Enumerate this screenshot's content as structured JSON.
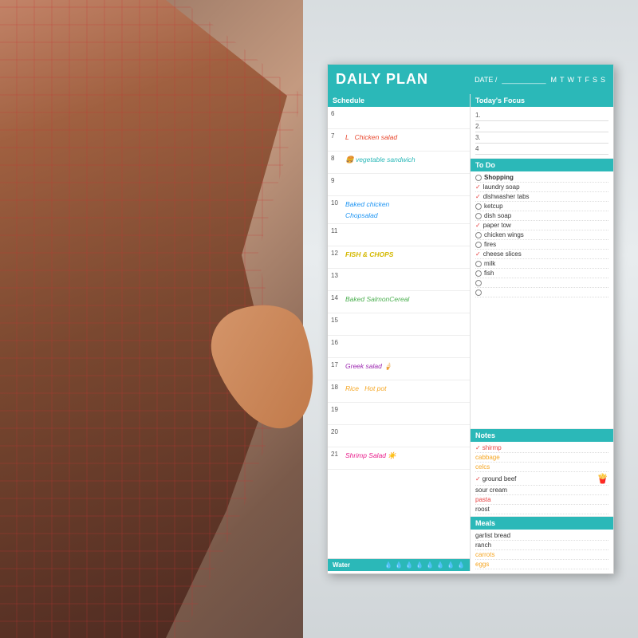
{
  "planner": {
    "title": "DAILY PLAN",
    "date_label": "DATE /",
    "days": [
      "M",
      "T",
      "W",
      "T",
      "F",
      "S",
      "S"
    ],
    "sections": {
      "schedule": "Schedule",
      "todays_focus": "Today's Focus",
      "to_do": "To Do",
      "notes": "Notes",
      "meals": "Meals",
      "water": "Water"
    },
    "schedule_items": [
      {
        "time": "6",
        "text": "",
        "color": ""
      },
      {
        "time": "7",
        "text": "L  Chicken salad",
        "color": "meal-red"
      },
      {
        "time": "8",
        "text": "vegetable sandwich",
        "color": "meal-teal"
      },
      {
        "time": "9",
        "text": "",
        "color": ""
      },
      {
        "time": "10",
        "text": "Baked chicken\nChopsalad",
        "color": "meal-blue"
      },
      {
        "time": "11",
        "text": "",
        "color": ""
      },
      {
        "time": "12",
        "text": "FISH & CHOPS",
        "color": "meal-yellow"
      },
      {
        "time": "13",
        "text": "",
        "color": ""
      },
      {
        "time": "14",
        "text": "Baked SalmonCereal",
        "color": "meal-green"
      },
      {
        "time": "15",
        "text": "",
        "color": ""
      },
      {
        "time": "16",
        "text": "",
        "color": ""
      },
      {
        "time": "17",
        "text": "Greek salad 🍦",
        "color": "meal-purple"
      },
      {
        "time": "18",
        "text": "Rice  Hot pot",
        "color": "meal-orange"
      },
      {
        "time": "19",
        "text": "",
        "color": ""
      },
      {
        "time": "20",
        "text": "",
        "color": ""
      },
      {
        "time": "21",
        "text": "Shrimp Salad ☀️",
        "color": "meal-pink"
      }
    ],
    "water_drops": [
      "💧",
      "💧",
      "💧",
      "💧",
      "💧",
      "💧",
      "💧",
      "💧"
    ],
    "focus_lines": [
      {
        "num": "1.",
        "text": ""
      },
      {
        "num": "2.",
        "text": ""
      },
      {
        "num": "3.",
        "text": ""
      },
      {
        "num": "4",
        "text": ""
      }
    ],
    "todo_items": [
      {
        "done": false,
        "category": true,
        "text": "Shopping"
      },
      {
        "done": true,
        "text": "laundry soap"
      },
      {
        "done": true,
        "text": "dishwasher tabs"
      },
      {
        "done": false,
        "text": "ketcup"
      },
      {
        "done": false,
        "text": "dish soap"
      },
      {
        "done": true,
        "text": "paper tow"
      },
      {
        "done": false,
        "text": "chicken wings"
      },
      {
        "done": false,
        "text": "fires"
      },
      {
        "done": true,
        "text": "cheese slices"
      },
      {
        "done": false,
        "text": "milk"
      },
      {
        "done": false,
        "text": "fish"
      },
      {
        "done": false,
        "text": ""
      },
      {
        "done": false,
        "text": ""
      }
    ],
    "notes_items": [
      {
        "check": true,
        "text": "shirmp",
        "color": "note-red"
      },
      {
        "check": false,
        "text": "cabbage",
        "color": "note-orange"
      },
      {
        "check": false,
        "text": "celcs",
        "color": "note-orange"
      },
      {
        "check": true,
        "text": "ground beef",
        "color": "note-black"
      },
      {
        "check": false,
        "text": "sour cream",
        "color": "note-black"
      },
      {
        "check": false,
        "text": "pasta",
        "color": "note-red"
      },
      {
        "check": false,
        "text": "roost",
        "color": "note-black"
      }
    ],
    "meals_items": [
      {
        "text": "garlist bread",
        "colored": false
      },
      {
        "text": "ranch",
        "colored": false
      },
      {
        "text": "carrots",
        "colored": true
      },
      {
        "text": "eggs",
        "colored": true
      }
    ]
  }
}
